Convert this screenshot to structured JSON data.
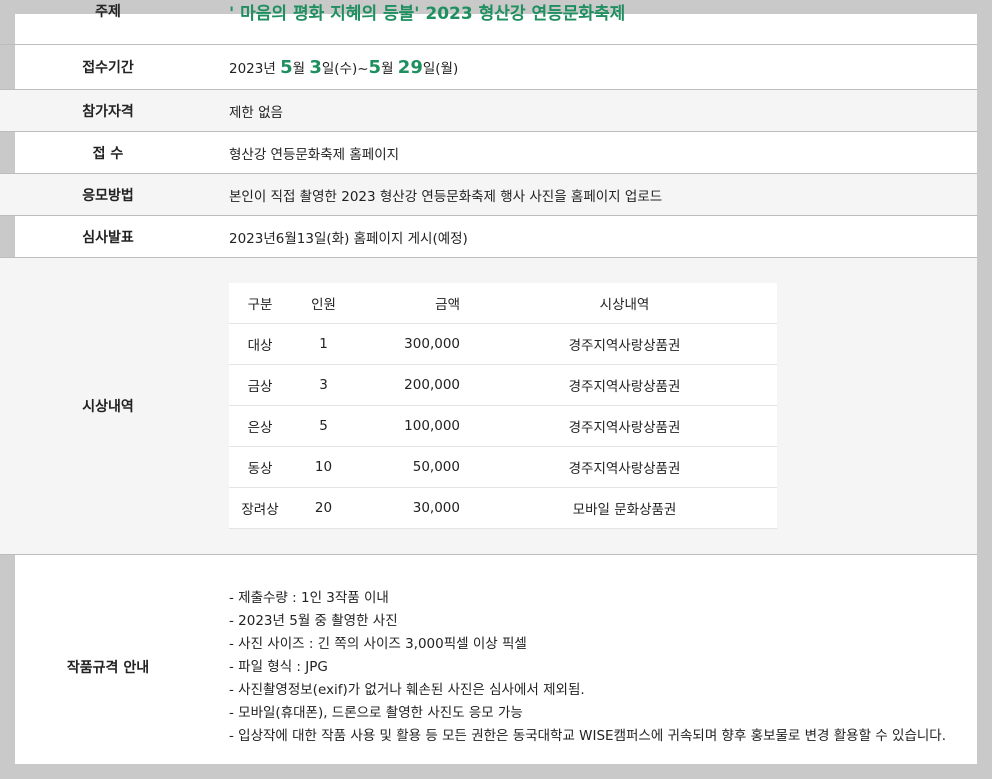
{
  "rows": {
    "subject": {
      "label": "주제",
      "value": "' 마음의 평화 지혜의 등불' 2023 형산강 연등문화축제"
    },
    "period": {
      "label": "접수기간",
      "year_text": "2023년 ",
      "start_month": "5",
      "month_unit": "월 ",
      "start_day": "3",
      "start_day_suffix": "일(수)~",
      "end_month": "5",
      "end_day": "29",
      "end_day_suffix": "일(월)"
    },
    "eligibility": {
      "label": "참가자격",
      "value": "제한 없음"
    },
    "submission": {
      "label": "접 수",
      "value": "형산강 연등문화축제 홈페이지"
    },
    "method": {
      "label": "응모방법",
      "value": "본인이 직접 촬영한 2023 형산강 연등문화축제 행사 사진을 홈페이지 업로드"
    },
    "announcement": {
      "label": "심사발표",
      "value": "2023년6월13일(화) 홈페이지 게시(예정)"
    },
    "awards": {
      "label": "시상내역",
      "headers": [
        "구분",
        "인원",
        "금액",
        "시상내역"
      ],
      "items": [
        [
          "대상",
          "1",
          "300,000",
          "경주지역사랑상품권"
        ],
        [
          "금상",
          "3",
          "200,000",
          "경주지역사랑상품권"
        ],
        [
          "은상",
          "5",
          "100,000",
          "경주지역사랑상품권"
        ],
        [
          "동상",
          "10",
          "50,000",
          "경주지역사랑상품권"
        ],
        [
          "장려상",
          "20",
          "30,000",
          "모바일 문화상품권"
        ]
      ]
    },
    "specs": {
      "label": "작품규격 안내",
      "items": [
        "- 제출수량 : 1인 3작품 이내",
        "- 2023년 5월 중 촬영한 사진",
        "- 사진 사이즈 : 긴 쪽의 사이즈 3,000픽셀 이상 픽셀",
        "- 파일 형식 : JPG",
        "- 사진촬영정보(exif)가 없거나 훼손된 사진은 심사에서 제외됨.",
        "- 모바일(휴대폰), 드론으로 촬영한 사진도 응모 가능",
        "- 입상작에 대한 작품 사용 및 활용 등 모든 권한은 동국대학교 WISE캠퍼스에 귀속되며 향후 홍보물로 변경 활용할 수 있습니다."
      ]
    }
  },
  "colors": {
    "accent": "#1f8f5f",
    "shade": "#f5f5f5",
    "border": "#bdbdbd"
  }
}
